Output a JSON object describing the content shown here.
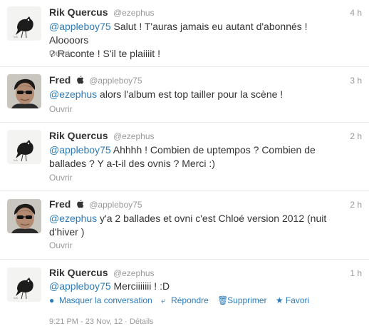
{
  "tweets": [
    {
      "name": "Rik Quercus",
      "handle": "@ezephus",
      "apple": false,
      "time": "4 h",
      "mention": "@appleboy75",
      "text_l1": " Salut ! T'auras jamais eu autant d'abonnés ! Aloooors",
      "text_l2": "? Raconte ! S'il te plaiiiit !",
      "open_label": "Ouvrir",
      "avatar": "bird-avatar"
    },
    {
      "name": "Fred",
      "handle": "@appleboy75",
      "apple": true,
      "time": "3 h",
      "mention": "@ezephus",
      "text_l1": " alors l'album est top tailler pour la scène !",
      "text_l2": "",
      "open_label": "Ouvrir",
      "avatar": "man-sunglasses-avatar"
    },
    {
      "name": "Rik Quercus",
      "handle": "@ezephus",
      "apple": false,
      "time": "2 h",
      "mention": "@appleboy75",
      "text_l1": " Ahhhh ! Combien de uptempos ? Combien de",
      "text_l2": "ballades ? Y a-t-il des ovnis ? Merci :)",
      "open_label": "Ouvrir",
      "avatar": "bird-avatar"
    },
    {
      "name": "Fred",
      "handle": "@appleboy75",
      "apple": true,
      "time": "2 h",
      "mention": "@ezephus",
      "text_l1": " y'a 2 ballades et ovni c'est Chloé version 2012 (nuit",
      "text_l2": "d'hiver )",
      "open_label": "Ouvrir",
      "avatar": "man-sunglasses-avatar"
    },
    {
      "name": "Rik Quercus",
      "handle": "@ezephus",
      "apple": false,
      "time": "1 h",
      "mention": "@appleboy75",
      "text_l1": " Merciiiiiii ! :D",
      "text_l2": "",
      "avatar": "bird-avatar",
      "actions": {
        "hide": "Masquer la conversation",
        "reply": "Répondre",
        "delete": "Supprimer",
        "favorite": "Favori"
      },
      "meta": "9:21 PM - 23 Nov, 12 · Détails"
    }
  ],
  "colors": {
    "link": "#2b7bb9",
    "muted": "#999999",
    "text": "#333333"
  },
  "icons": [
    "bird-icon",
    "apple-icon",
    "collapse-icon",
    "reply-icon",
    "trash-icon",
    "star-icon"
  ]
}
